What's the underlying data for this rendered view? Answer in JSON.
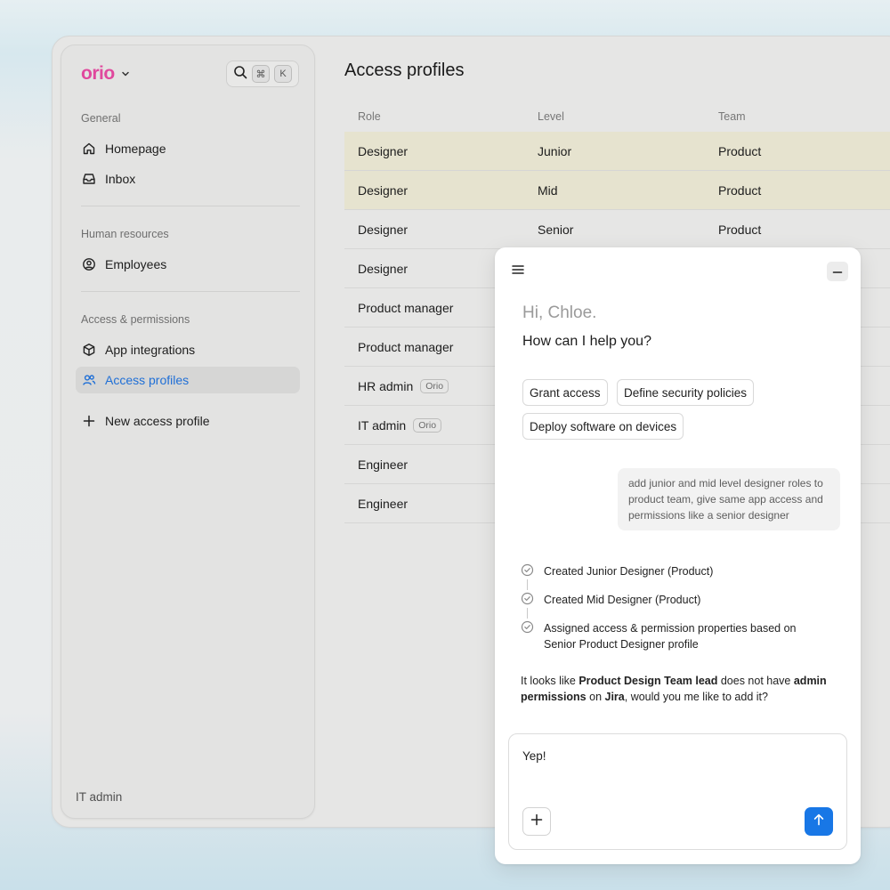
{
  "brand": {
    "name": "orio"
  },
  "sidebar": {
    "sections": [
      {
        "label": "General",
        "items": [
          {
            "label": "Homepage",
            "icon": "home-icon"
          },
          {
            "label": "Inbox",
            "icon": "inbox-icon"
          }
        ]
      },
      {
        "label": "Human resources",
        "items": [
          {
            "label": "Employees",
            "icon": "user-circle-icon"
          }
        ]
      },
      {
        "label": "Access & permissions",
        "items": [
          {
            "label": "App integrations",
            "icon": "cube-icon"
          },
          {
            "label": "Access profiles",
            "icon": "users-icon",
            "active": true
          }
        ]
      }
    ],
    "new_profile_label": "New access profile",
    "footer": "IT admin"
  },
  "search": {
    "shortcut_mod": "⌘",
    "shortcut_key": "K"
  },
  "main": {
    "title": "Access profiles",
    "columns": [
      "Role",
      "Level",
      "Team"
    ],
    "rows": [
      {
        "role": "Designer",
        "level": "Junior",
        "team": "Product",
        "badge": ""
      },
      {
        "role": "Designer",
        "level": "Mid",
        "team": "Product",
        "badge": ""
      },
      {
        "role": "Designer",
        "level": "Senior",
        "team": "Product",
        "badge": ""
      },
      {
        "role": "Designer",
        "level": "",
        "team": "",
        "badge": ""
      },
      {
        "role": "Product manager",
        "level": "",
        "team": "",
        "badge": ""
      },
      {
        "role": "Product manager",
        "level": "",
        "team": "",
        "badge": ""
      },
      {
        "role": "HR admin",
        "level": "",
        "team": "",
        "badge": "Orio"
      },
      {
        "role": "IT admin",
        "level": "",
        "team": "",
        "badge": "Orio"
      },
      {
        "role": "Engineer",
        "level": "",
        "team": "",
        "badge": ""
      },
      {
        "role": "Engineer",
        "level": "",
        "team": "",
        "badge": ""
      }
    ],
    "highlight_color": "#e6e3cf"
  },
  "assistant": {
    "greeting": "Hi, Chloe.",
    "prompt": "How can I help you?",
    "suggestions": [
      "Grant access",
      "Define security policies",
      "Deploy software on devices"
    ],
    "user_message": "add junior and mid level designer roles to product team, give same app access and permissions like a senior designer",
    "steps": [
      "Created Junior Designer (Product)",
      "Created Mid Designer (Product)",
      "Assigned access & permission properties based on Senior Product Designer profile"
    ],
    "reply": {
      "p1": "It looks like ",
      "b1": "Product Design Team lead",
      "p2": " does not have ",
      "b2": "admin permissions",
      "p3": " on ",
      "b3": "Jira",
      "p4": ", would you me like to add it?"
    },
    "composer_value": "Yep!",
    "accent_color": "#1877e6"
  }
}
